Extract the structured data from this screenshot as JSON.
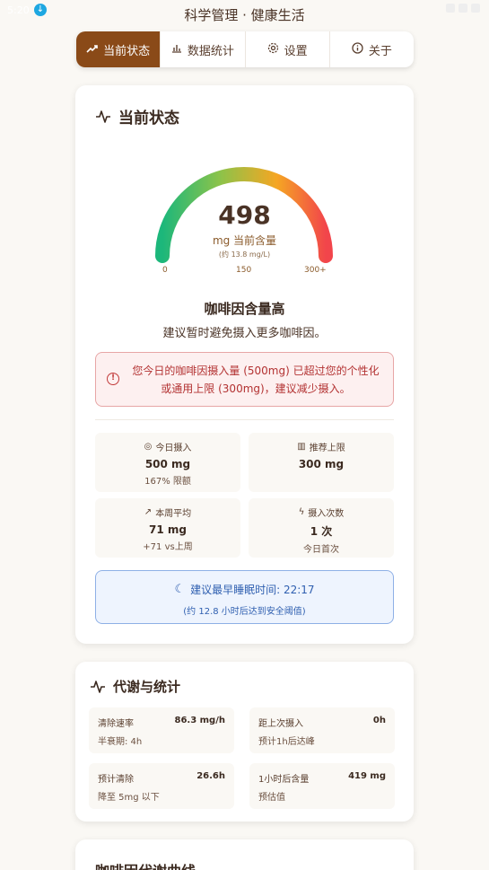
{
  "status_bar": {
    "time": "5:20"
  },
  "app_title": "科学管理 · 健康生活",
  "tabs": [
    {
      "label": "当前状态",
      "icon": "trend-up-icon",
      "active": true
    },
    {
      "label": "数据统计",
      "icon": "bar-chart-icon",
      "active": false
    },
    {
      "label": "设置",
      "icon": "gear-icon",
      "active": false
    },
    {
      "label": "关于",
      "icon": "info-icon",
      "active": false
    }
  ],
  "current": {
    "title": "当前状态",
    "gauge": {
      "value": "498",
      "unit": "mg 当前含量",
      "sub": "(约 13.8 mg/L)",
      "level_fraction": 0.83,
      "ticks": [
        "0",
        "150",
        "300+"
      ],
      "colors": [
        "#1cb77b",
        "#8bc34a",
        "#f5a623",
        "#f2454b"
      ]
    },
    "level_title": "咖啡因含量高",
    "level_desc": "建议暂时避免摄入更多咖啡因。",
    "alert_text": "您今日的咖啡因摄入量 (500mg) 已超过您的个性化或通用上限 (300mg)，建议减少摄入。",
    "stats": [
      {
        "label": "今日摄入",
        "icon": "target-icon",
        "value": "500 mg",
        "sub": "167% 限额"
      },
      {
        "label": "推荐上限",
        "icon": "bar-chart-icon",
        "value": "300 mg",
        "sub": ""
      },
      {
        "label": "本周平均",
        "icon": "trend-up-icon",
        "value": "71 mg",
        "sub": "+71 vs上周"
      },
      {
        "label": "摄入次数",
        "icon": "zap-icon",
        "value": "1 次",
        "sub": "今日首次"
      }
    ],
    "sleep": {
      "line1": "建议最早睡眠时间: 22:17",
      "line2": "(约 12.8 小时后达到安全阈值)"
    }
  },
  "metabolism": {
    "title": "代谢与统计",
    "items": [
      {
        "label": "清除速率",
        "value": "86.3 mg/h",
        "sub": "半衰期: 4h"
      },
      {
        "label": "距上次摄入",
        "value": "0h",
        "sub": "预计1h后达峰"
      },
      {
        "label": "预计清除",
        "value": "26.6h",
        "sub": "降至 5mg 以下"
      },
      {
        "label": "1小时后含量",
        "value": "419 mg",
        "sub": "预估值"
      }
    ]
  },
  "curve": {
    "title": "咖啡因代谢曲线"
  }
}
